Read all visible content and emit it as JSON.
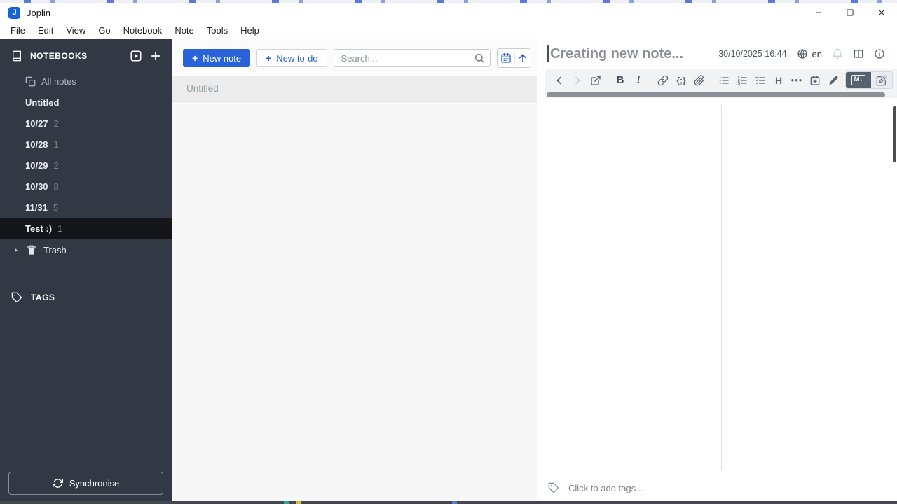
{
  "titlebar": {
    "app_title": "Joplin"
  },
  "menubar": {
    "items": [
      "File",
      "Edit",
      "View",
      "Go",
      "Notebook",
      "Note",
      "Tools",
      "Help"
    ]
  },
  "sidebar": {
    "notebooks_header": "NOTEBOOKS",
    "all_notes_label": "All notes",
    "notebooks": [
      {
        "label": "Untitled",
        "count": ""
      },
      {
        "label": "10/27",
        "count": "2"
      },
      {
        "label": "10/28",
        "count": "1"
      },
      {
        "label": "10/29",
        "count": "2"
      },
      {
        "label": "10/30",
        "count": "8"
      },
      {
        "label": "11/31",
        "count": "5"
      },
      {
        "label": "Test :)",
        "count": "1"
      }
    ],
    "trash_label": "Trash",
    "tags_header": "TAGS",
    "sync_label": "Synchronise"
  },
  "notelist": {
    "plus": "+",
    "new_note_label": "New note",
    "new_todo_label": "New to-do",
    "search_placeholder": "Search...",
    "notes": [
      {
        "title": "Untitled"
      }
    ]
  },
  "editor": {
    "title": "Creating new note...",
    "timestamp": "30/10/2025 16:44",
    "language": "en",
    "toolbar": {
      "bold": "B",
      "italic": "I",
      "code": "{;}",
      "heading": "H",
      "more": "•••",
      "markdown_toggle": "M↓"
    },
    "tags_placeholder": "Click to add tags..."
  },
  "colors": {
    "accent": "#2a63d9",
    "sidebar_bg": "#323945",
    "sidebar_selected": "#131519",
    "toolbar_icon": "#57636f"
  }
}
